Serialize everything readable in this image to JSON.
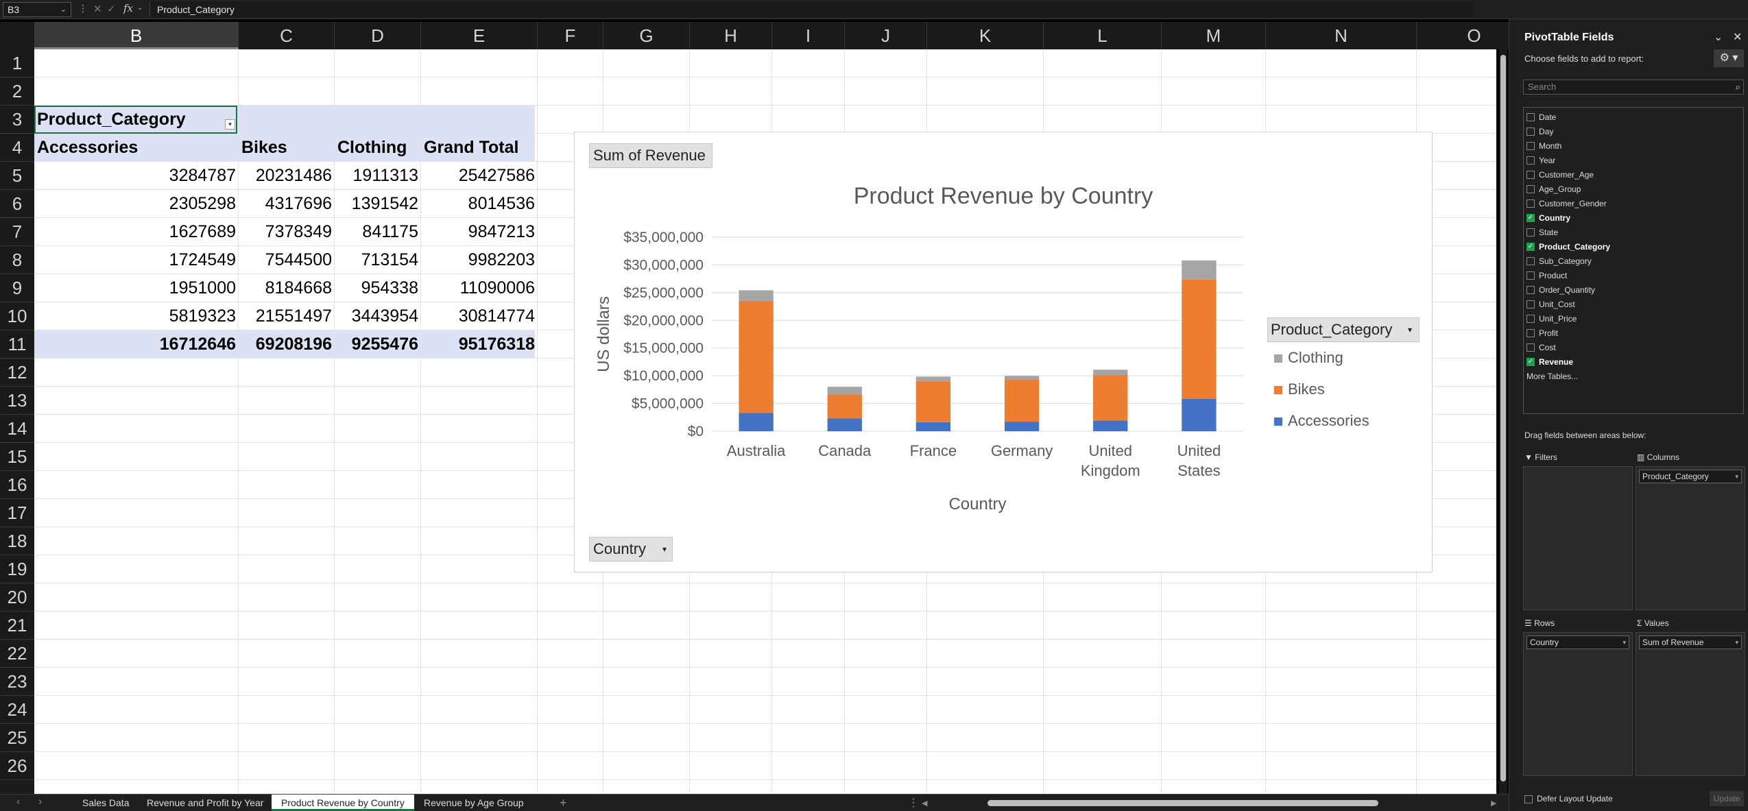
{
  "formula_bar": {
    "name_box": "B3",
    "fx_label": "fx",
    "formula": "Product_Category"
  },
  "columns": [
    "B",
    "C",
    "D",
    "E",
    "F",
    "G",
    "H",
    "I",
    "J",
    "K",
    "L",
    "M",
    "N",
    "O"
  ],
  "rows": [
    "1",
    "2",
    "3",
    "4",
    "5",
    "6",
    "7",
    "8",
    "9",
    "10",
    "11",
    "12",
    "13",
    "14",
    "15",
    "16",
    "17",
    "18",
    "19",
    "20",
    "21",
    "22",
    "23",
    "24",
    "25",
    "26"
  ],
  "pivot_table": {
    "label": "Product_Category",
    "headers": [
      "Accessories",
      "Bikes",
      "Clothing",
      "Grand Total"
    ],
    "data_rows": [
      [
        "3284787",
        "20231486",
        "1911313",
        "25427586"
      ],
      [
        "2305298",
        "4317696",
        "1391542",
        "8014536"
      ],
      [
        "1627689",
        "7378349",
        "841175",
        "9847213"
      ],
      [
        "1724549",
        "7544500",
        "713154",
        "9982203"
      ],
      [
        "1951000",
        "8184668",
        "954338",
        "11090006"
      ],
      [
        "5819323",
        "21551497",
        "3443954",
        "30814774"
      ]
    ],
    "total_row": [
      "16712646",
      "69208196",
      "9255476",
      "95176318"
    ]
  },
  "chart": {
    "sum_button": "Sum of Revenue",
    "country_button": "Country",
    "legend_title": "Product_Category",
    "colors": {
      "Accessories": "#4472c4",
      "Bikes": "#ed7d31",
      "Clothing": "#a5a5a5"
    }
  },
  "chart_data": {
    "type": "bar",
    "stacked": true,
    "title": "Product Revenue by Country",
    "xlabel": "Country",
    "ylabel": "US dollars",
    "ylim": [
      0,
      35000000
    ],
    "yticks": [
      "$0",
      "$5,000,000",
      "$10,000,000",
      "$15,000,000",
      "$20,000,000",
      "$25,000,000",
      "$30,000,000",
      "$35,000,000"
    ],
    "categories": [
      "Australia",
      "Canada",
      "France",
      "Germany",
      "United Kingdom",
      "United States"
    ],
    "category_lines": [
      [
        "Australia"
      ],
      [
        "Canada"
      ],
      [
        "France"
      ],
      [
        "Germany"
      ],
      [
        "United",
        "Kingdom"
      ],
      [
        "United",
        "States"
      ]
    ],
    "series": [
      {
        "name": "Accessories",
        "values": [
          3284787,
          2305298,
          1627689,
          1724549,
          1951000,
          5819323
        ]
      },
      {
        "name": "Bikes",
        "values": [
          20231486,
          4317696,
          7378349,
          7544500,
          8184668,
          21551497
        ]
      },
      {
        "name": "Clothing",
        "values": [
          1911313,
          1391542,
          841175,
          713154,
          954338,
          3443954
        ]
      }
    ],
    "legend_order": [
      "Clothing",
      "Bikes",
      "Accessories"
    ],
    "grid": true,
    "legend_position": "right"
  },
  "sheet_tabs": [
    "Sales Data",
    "Revenue and Profit by Year",
    "Product Revenue by Country",
    "Revenue by Age Group"
  ],
  "active_tab": "Product Revenue by Country",
  "pivot_panel": {
    "title": "PivotTable Fields",
    "subtitle": "Choose fields to add to report:",
    "search_placeholder": "Search",
    "fields": [
      {
        "name": "Date",
        "checked": false
      },
      {
        "name": "Day",
        "checked": false
      },
      {
        "name": "Month",
        "checked": false
      },
      {
        "name": "Year",
        "checked": false
      },
      {
        "name": "Customer_Age",
        "checked": false
      },
      {
        "name": "Age_Group",
        "checked": false
      },
      {
        "name": "Customer_Gender",
        "checked": false
      },
      {
        "name": "Country",
        "checked": true
      },
      {
        "name": "State",
        "checked": false
      },
      {
        "name": "Product_Category",
        "checked": true
      },
      {
        "name": "Sub_Category",
        "checked": false
      },
      {
        "name": "Product",
        "checked": false
      },
      {
        "name": "Order_Quantity",
        "checked": false
      },
      {
        "name": "Unit_Cost",
        "checked": false
      },
      {
        "name": "Unit_Price",
        "checked": false
      },
      {
        "name": "Profit",
        "checked": false
      },
      {
        "name": "Cost",
        "checked": false
      },
      {
        "name": "Revenue",
        "checked": true
      }
    ],
    "more_tables": "More Tables...",
    "drag_label": "Drag fields between areas below:",
    "filters_label": "Filters",
    "columns_label": "Columns",
    "columns_item": "Product_Category",
    "rows_label": "Rows",
    "rows_item": "Country",
    "values_label": "Values",
    "values_item": "Sum of Revenue",
    "defer_label": "Defer Layout Update",
    "update_label": "Update"
  }
}
